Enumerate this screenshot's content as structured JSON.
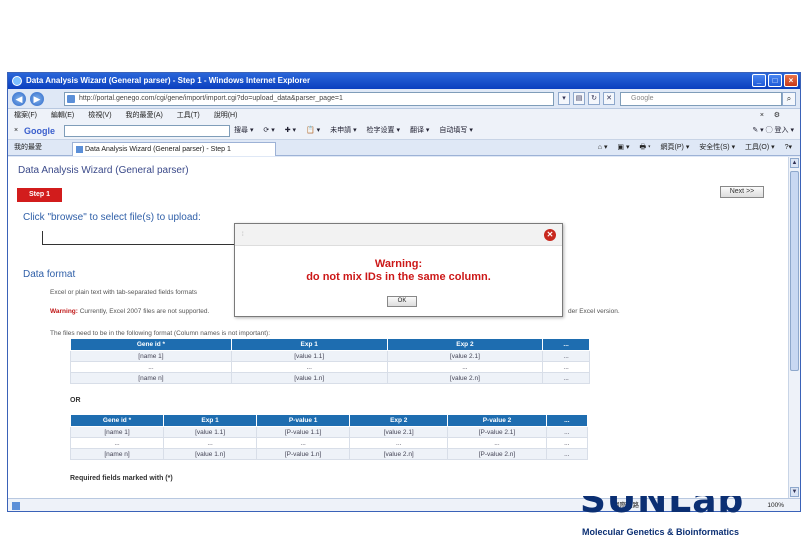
{
  "window": {
    "title": "Data Analysis Wizard (General parser) - Step 1 - Windows Internet Explorer",
    "buttons": [
      "_",
      "□",
      "×"
    ]
  },
  "address_bar": {
    "url": "http://portal.genego.com/cgi/gene/import/import.cgi?do=upload_data&parser_page=1",
    "search_placeholder": "Google"
  },
  "menu": {
    "items": [
      "檔案(F)",
      "編輯(E)",
      "檢視(V)",
      "我的最愛(A)",
      "工具(T)",
      "說明(H)"
    ],
    "close": "×",
    "gear": "⚙"
  },
  "google_toolbar": {
    "x": "×",
    "logo": "Google",
    "items": [
      "搜尋 ▾",
      "⟳ ▾",
      "✚ ▾",
      "📋 ▾",
      "未申請 ▾",
      "检字设置 ▾",
      "翻译 ▾",
      "自动填写 ▾"
    ],
    "right": "✎ ▾  ◯ 登入 ▾"
  },
  "tab_bar": {
    "favorites": "我的最愛",
    "tab_label": "Data Analysis Wizard (General parser) - Step 1",
    "right_items": [
      "⌂ ▾",
      "▣ ▾",
      "🖶 ▾",
      "網頁(P) ▾",
      "安全性(S) ▾",
      "工具(O) ▾",
      "?▾"
    ]
  },
  "page": {
    "title": "Data Analysis Wizard (General parser)",
    "step": "Step 1",
    "next": "Next >>",
    "upload_title": "Click \"browse\" to select file(s) to upload:",
    "format_title": "Data format",
    "format_line1": "Excel or plain text with tab-separated fields formats",
    "format_warning_label": "Warning:",
    "format_warning_text": " Currently, Excel 2007 files are not supported.",
    "format_warning_tail": "der Excel version.",
    "format_line3": "The files need to be in the following format (Column names is not important):",
    "or_label": "OR",
    "required_label": "Required fields marked with (*)"
  },
  "table1": {
    "headers": [
      "Gene id *",
      "Exp 1",
      "Exp 2",
      "..."
    ],
    "rows": [
      [
        "[name 1]",
        "[value 1.1]",
        "[value 2.1]",
        "..."
      ],
      [
        "...",
        "...",
        "...",
        "..."
      ],
      [
        "[name n]",
        "[value 1.n]",
        "[value 2.n]",
        "..."
      ]
    ]
  },
  "table2": {
    "headers": [
      "Gene id *",
      "Exp 1",
      "P-value 1",
      "Exp 2",
      "P-value 2",
      "..."
    ],
    "rows": [
      [
        "[name 1]",
        "[value 1.1]",
        "[P-value 1.1]",
        "[value 2.1]",
        "[P-value 2.1]",
        "..."
      ],
      [
        "...",
        "...",
        "...",
        "...",
        "...",
        "..."
      ],
      [
        "[name n]",
        "[value 1.n]",
        "[P-value 1.n]",
        "[value 2.n]",
        "[P-value 2.n]",
        "..."
      ]
    ]
  },
  "dialog": {
    "line1": "Warning:",
    "line2": "do not mix IDs in the same column.",
    "ok": "OK"
  },
  "status_bar": {
    "zone": "網際網路",
    "zoom": "100%"
  },
  "footer": {
    "logo": "SUNLab",
    "subtitle": "Molecular Genetics & Bioinformatics"
  },
  "colors": {
    "title_blue": "#2f5fa8",
    "header_blue": "#1e6db0",
    "step_red": "#d21c1c",
    "warning_red": "#cc1818",
    "logo_navy": "#0b2f73"
  }
}
